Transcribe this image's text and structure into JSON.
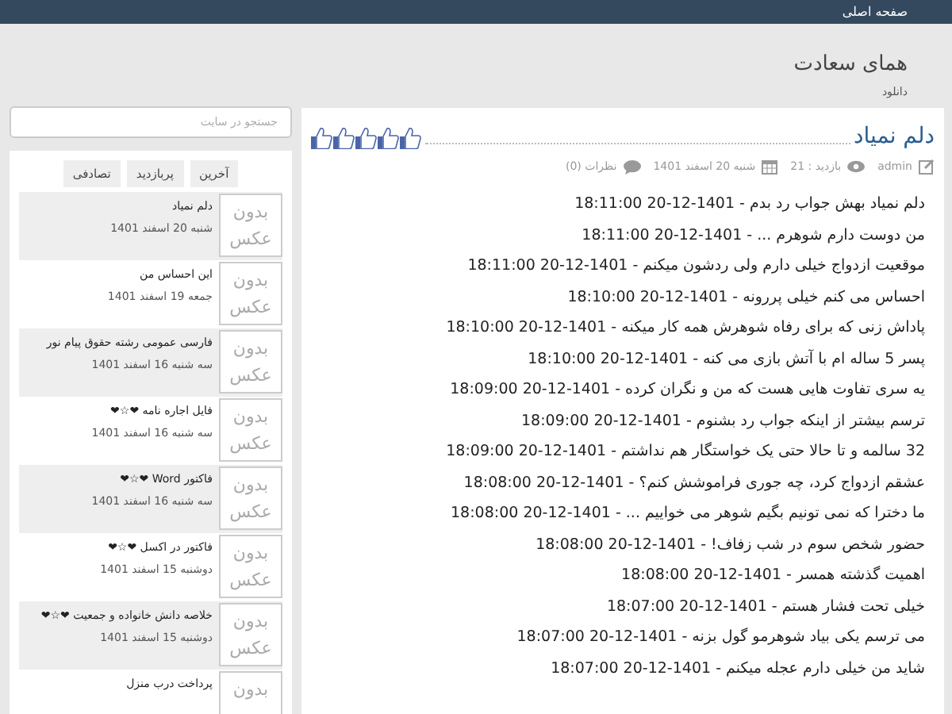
{
  "top_bar": {
    "home_link": "صفحه اصلی"
  },
  "header": {
    "title": "همای سعادت",
    "subtitle": "دانلود"
  },
  "post": {
    "title": "دلم نمیاد",
    "meta": {
      "author": "admin",
      "views": "بازدید : 21",
      "date": "شنبه 20 اسفند 1401",
      "comments": "نظرات (0)"
    },
    "lines": [
      "دلم نمیاد بهش جواب رد بدم - 1401-12-20 18:11:00",
      "من دوست دارم شوهرم ... - 1401-12-20 18:11:00",
      "موقعیت ازدواج خیلی دارم ولی ردشون میکنم - 1401-12-20 18:11:00",
      "احساس می کنم خیلی پررونه - 1401-12-20 18:10:00",
      "پاداش زنی که برای رفاه شوهرش همه کار میکنه - 1401-12-20 18:10:00",
      "پسر 5 ساله ام با آتش بازی می کنه - 1401-12-20 18:10:00",
      "یه سری تفاوت هایی هست که من و نگران کرده - 1401-12-20 18:09:00",
      "ترسم بیشتر از اینکه جواب رد بشنوم - 1401-12-20 18:09:00",
      "32 سالمه و تا حالا حتی یک خواستگار هم نداشتم - 1401-12-20 18:09:00",
      "عشقم ازدواج کرد، چه جوری فراموشش کنم؟ - 1401-12-20 18:08:00",
      "ما دخترا که نمی تونیم بگیم شوهر می خواییم ... - 1401-12-20 18:08:00",
      "حضور شخص سوم در شب زفاف! - 1401-12-20 18:08:00",
      "اهمیت گذشته همسر - 1401-12-20 18:08:00",
      "خیلی تحت فشار هستم - 1401-12-20 18:07:00",
      "می ترسم یکی بیاد شوهرمو گول بزنه - 1401-12-20 18:07:00",
      "شاید من خیلی دارم عجله میکنم - 1401-12-20 18:07:00"
    ]
  },
  "sidebar": {
    "search": {
      "placeholder": "جستجو در سایت"
    },
    "tabs": [
      {
        "label": "آخرین"
      },
      {
        "label": "پربازدید"
      },
      {
        "label": "تصادفی"
      }
    ],
    "items": [
      {
        "thumb": "بدون عکس",
        "title": "دلم نمیاد",
        "date": "شنبه 20 اسفند 1401"
      },
      {
        "thumb": "بدون عکس",
        "title": "این احساس من",
        "date": "جمعه 19 اسفند 1401"
      },
      {
        "thumb": "بدون عکس",
        "title": "فارسی عمومی رشته حقوق پیام نور",
        "date": "سه شنبه 16 اسفند 1401"
      },
      {
        "thumb": "بدون عکس",
        "title": "فایل اجاره نامه ❤☆❤",
        "date": "سه شنبه 16 اسفند 1401"
      },
      {
        "thumb": "بدون عکس",
        "title": "فاکتور Word ❤☆❤",
        "date": "سه شنبه 16 اسفند 1401"
      },
      {
        "thumb": "بدون عکس",
        "title": "فاکتور در اکسل ❤☆❤",
        "date": "دوشنبه 15 اسفند 1401"
      },
      {
        "thumb": "بدون عکس",
        "title": "خلاصه دانش خانواده و جمعیت ❤☆❤",
        "date": "دوشنبه 15 اسفند 1401"
      },
      {
        "thumb": "بدون",
        "title": "پرداخت درب منزل"
      }
    ]
  }
}
